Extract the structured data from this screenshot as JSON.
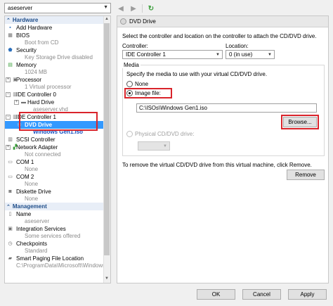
{
  "vm_select": {
    "value": "aseserver"
  },
  "left": {
    "hardware_header": "Hardware",
    "management_header": "Management",
    "items": {
      "add_hardware": "Add Hardware",
      "bios": "BIOS",
      "bios_sub": "Boot from CD",
      "security": "Security",
      "security_sub": "Key Storage Drive disabled",
      "memory": "Memory",
      "memory_sub": "1024 MB",
      "processor": "Processor",
      "processor_sub": "1 Virtual processor",
      "ide0": "IDE Controller 0",
      "hard_drive": "Hard Drive",
      "hard_drive_sub": "aseserver.vhd",
      "ide1": "IDE Controller 1",
      "dvd_drive": "DVD Drive",
      "dvd_sub": "Windows Gen1.iso",
      "scsi": "SCSI Controller",
      "network": "Network Adapter",
      "network_sub": "Not connected",
      "com1": "COM 1",
      "com1_sub": "None",
      "com2": "COM 2",
      "com2_sub": "None",
      "diskette": "Diskette Drive",
      "diskette_sub": "None",
      "name": "Name",
      "name_sub": "aseserver",
      "integration": "Integration Services",
      "integration_sub": "Some services offered",
      "checkpoints": "Checkpoints",
      "checkpoints_sub": "Standard",
      "paging": "Smart Paging File Location",
      "paging_sub": "C:\\ProgramData\\Microsoft\\Windows"
    }
  },
  "right": {
    "header": "DVD Drive",
    "description": "Select the controller and location on the controller to attach the CD/DVD drive.",
    "controller_label": "Controller:",
    "controller_value": "IDE Controller 1",
    "location_label": "Location:",
    "location_value": "0 (in use)",
    "media_label": "Media",
    "media_desc": "Specify the media to use with your virtual CD/DVD drive.",
    "none_label": "None",
    "image_file_label": "Image file:",
    "image_path": "C:\\ISOs\\Windows Gen1.iso",
    "browse_label": "Browse...",
    "physical_label": "Physical CD/DVD drive:",
    "remove_desc": "To remove the virtual CD/DVD drive from this virtual machine, click Remove.",
    "remove_label": "Remove"
  },
  "footer": {
    "ok": "OK",
    "cancel": "Cancel",
    "apply": "Apply"
  },
  "colors": {
    "highlight": "#d9242b",
    "selection": "#3399ff",
    "link_blue": "#1650c0"
  }
}
